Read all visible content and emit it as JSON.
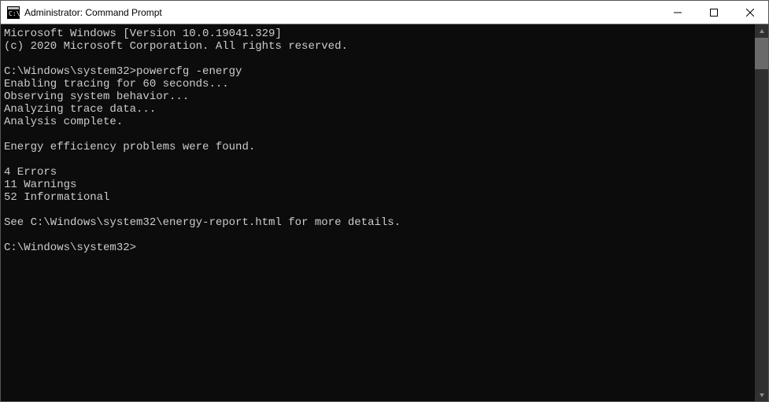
{
  "window": {
    "title": "Administrator: Command Prompt"
  },
  "terminal": {
    "lines": [
      "Microsoft Windows [Version 10.0.19041.329]",
      "(c) 2020 Microsoft Corporation. All rights reserved.",
      "",
      "C:\\Windows\\system32>powercfg -energy",
      "Enabling tracing for 60 seconds...",
      "Observing system behavior...",
      "Analyzing trace data...",
      "Analysis complete.",
      "",
      "Energy efficiency problems were found.",
      "",
      "4 Errors",
      "11 Warnings",
      "52 Informational",
      "",
      "See C:\\Windows\\system32\\energy-report.html for more details.",
      "",
      "C:\\Windows\\system32>"
    ],
    "prompt_path": "C:\\Windows\\system32>",
    "command": "powercfg -energy",
    "summary": {
      "errors": 4,
      "warnings": 11,
      "informational": 52
    },
    "report_path": "C:\\Windows\\system32\\energy-report.html"
  }
}
